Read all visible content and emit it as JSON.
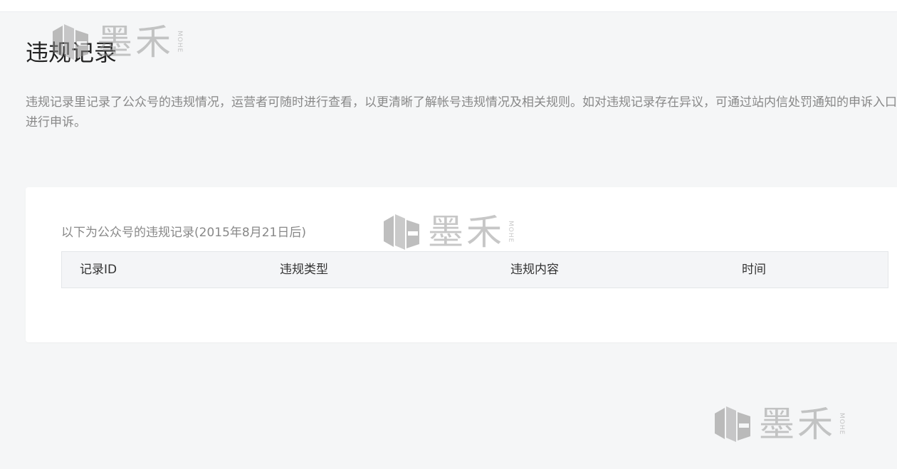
{
  "page": {
    "title": "违规记录",
    "description": "违规记录里记录了公众号的违规情况，运营者可随时进行查看，以更清晰了解帐号违规情况及相关规则。如对违规记录存在异议，可通过站内信处罚通知的申诉入口进行申诉。"
  },
  "violations_table": {
    "caption": "以下为公众号的违规记录(2015年8月21日后)",
    "columns": [
      "记录ID",
      "违规类型",
      "违规内容",
      "时间"
    ],
    "rows": []
  },
  "watermark": {
    "text": "墨禾",
    "subtext": "MOHE"
  },
  "colors": {
    "page_bg": "#f5f6f7",
    "card_bg": "#ffffff",
    "header_bg": "#f4f5f7",
    "muted_text": "#888888"
  }
}
